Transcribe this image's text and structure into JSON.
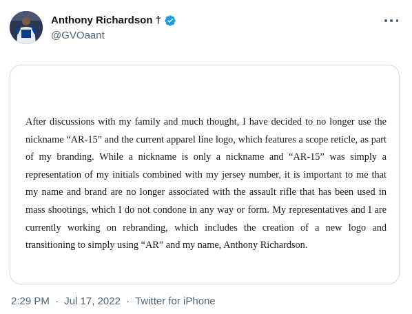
{
  "author": {
    "display_name": "Anthony Richardson",
    "dagger": "†",
    "handle": "@GVOaant",
    "avatar_icon": "avatar-photo",
    "verified_icon": "verified-badge-icon",
    "verified_color": "#1d9bf0"
  },
  "more_icon": "more-options-icon",
  "media": {
    "statement": "After discussions with my family and much thought, I have decided to no longer use the nickname “AR-15” and the current apparel line logo, which features a scope reticle, as part of my branding. While a nickname is only a nickname and “AR-15” was simply a representation of my initials combined with my jersey number, it is important to me that my name and brand are no longer associated with the assault rifle that has been used in mass shootings, which I do not condone in any way or form. My representatives and I are currently working on rebranding, which includes the creation of a new logo and transitioning to simply using “AR” and my name, Anthony Richardson."
  },
  "meta": {
    "time": "2:29 PM",
    "separator": "·",
    "date": "Jul 17, 2022",
    "source": "Twitter for iPhone"
  },
  "colors": {
    "text_primary": "#0f1419",
    "text_secondary": "#536471",
    "border": "#cfd9de"
  }
}
